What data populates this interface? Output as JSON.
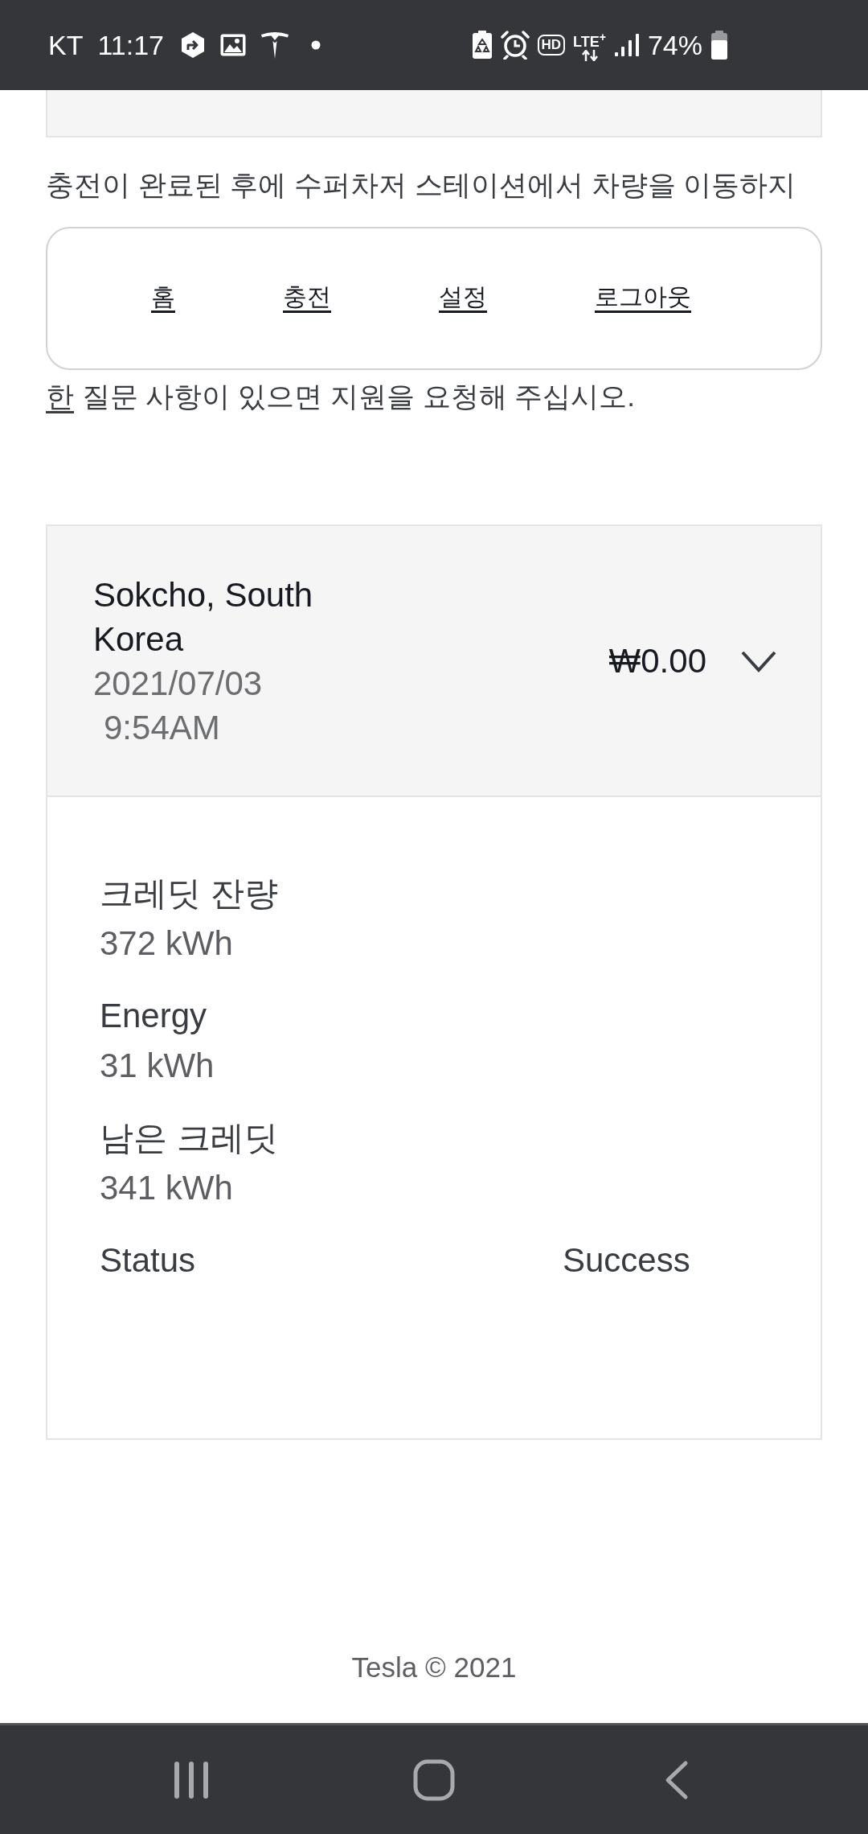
{
  "status_bar": {
    "carrier": "KT",
    "time": "11:17",
    "hd_label": "HD",
    "network": "LTE$^{+}$",
    "battery_percent": "74%"
  },
  "notice": {
    "top_line": "충전이 완료된 후에 수퍼차저 스테이션에서 차량을 이동하지",
    "bottom_line": {
      "link": "한",
      "text": " 질문 사항이 있으면 지원을 요청해 주십시오."
    }
  },
  "nav": {
    "links": [
      "홈",
      "충전",
      "설정",
      "로그아웃"
    ]
  },
  "charging_session": {
    "location": "Sokcho, South Korea",
    "date": "2021/07/03",
    "time": "9:54AM",
    "amount": "₩0.00",
    "expanded": true,
    "details": [
      {
        "kind": "stacked",
        "label": "크레딧 잔량",
        "value": "372 kWh"
      },
      {
        "kind": "stacked",
        "label": "Energy",
        "value": "31 kWh"
      },
      {
        "kind": "stacked",
        "label": "남은 크레딧",
        "value": "341 kWh"
      },
      {
        "kind": "inline",
        "label": "Status",
        "value": "Success"
      }
    ]
  },
  "footer": {
    "copyright": "Tesla © 2021"
  }
}
